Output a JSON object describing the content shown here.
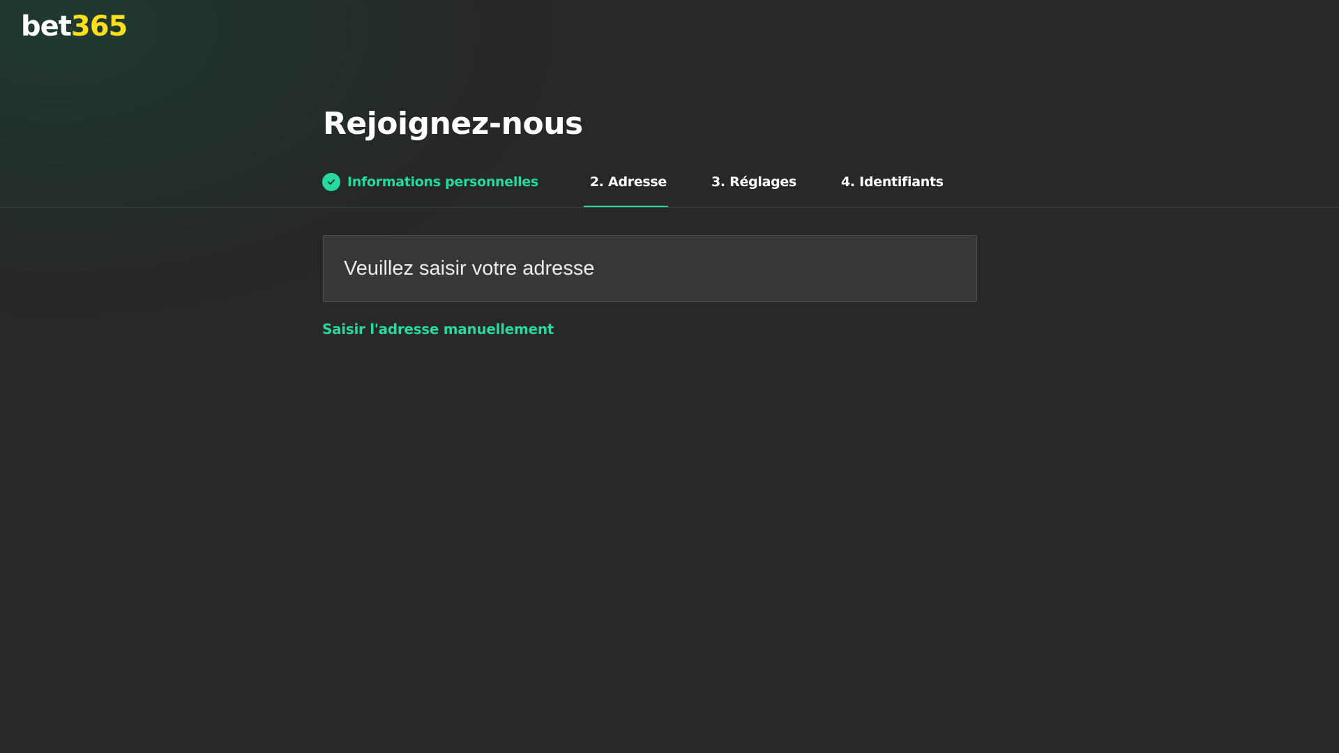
{
  "brand": {
    "logo_part1": "bet",
    "logo_part2": "365",
    "logo_color_white": "#ffffff",
    "logo_color_yellow": "#ffdf1b"
  },
  "page": {
    "title": "Rejoignez-nous"
  },
  "steps": [
    {
      "label": "Informations personnelles",
      "state": "completed",
      "icon": "check-circle-icon"
    },
    {
      "label": "2. Adresse",
      "state": "active"
    },
    {
      "label": "3. Réglages",
      "state": "upcoming"
    },
    {
      "label": "4. Identifiants",
      "state": "upcoming"
    }
  ],
  "address": {
    "placeholder": "Veuillez saisir votre adresse",
    "value": ""
  },
  "manual_link": {
    "label": "Saisir l'adresse manuellement"
  },
  "colors": {
    "accent": "#26d9a0",
    "background": "#282828",
    "input_bg": "#373737"
  }
}
